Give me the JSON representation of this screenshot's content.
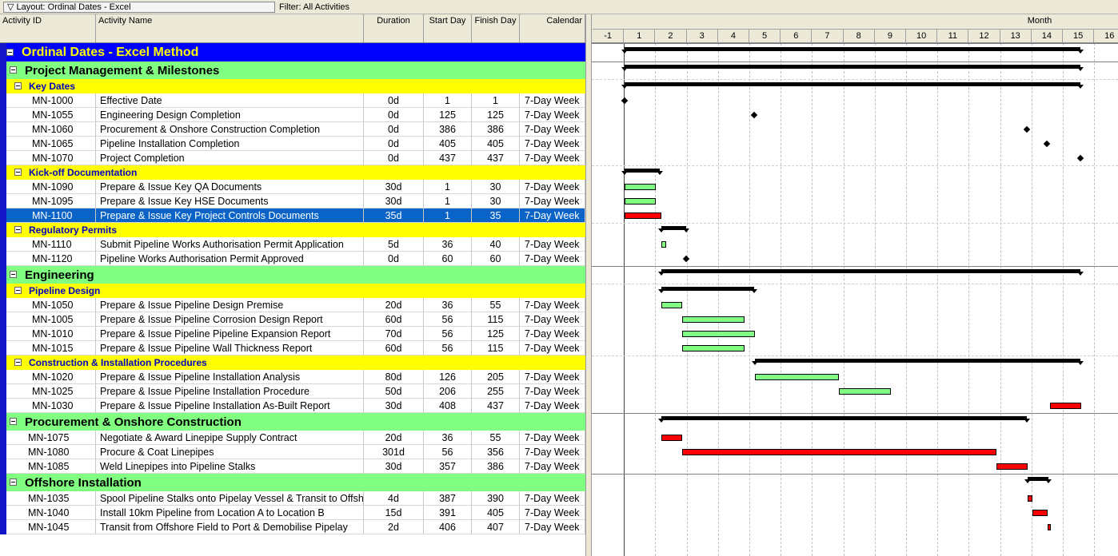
{
  "toolbar": {
    "layout_label": "Layout: Ordinal Dates - Excel",
    "filter_label": "Filter: All Activities"
  },
  "columns": {
    "id": "Activity ID",
    "name": "Activity Name",
    "duration": "Duration",
    "start": "Start Day",
    "finish": "Finish Day",
    "calendar": "Calendar"
  },
  "timescale": {
    "month_label": "Month",
    "ticks": [
      "-1",
      "1",
      "2",
      "3",
      "4",
      "5",
      "6",
      "7",
      "8",
      "9",
      "10",
      "11",
      "12",
      "13",
      "14",
      "15",
      "16"
    ]
  },
  "rows": [
    {
      "kind": "group",
      "level": 0,
      "title": "Ordinal Dates - Excel Method"
    },
    {
      "kind": "group",
      "level": 1,
      "title": "Project Management & Milestones"
    },
    {
      "kind": "group",
      "level": 2,
      "title": "Key Dates"
    },
    {
      "kind": "act",
      "id": "MN-1000",
      "name": "Effective Date",
      "dur": "0d",
      "sd": "1",
      "fd": "1",
      "cal": "7-Day Week"
    },
    {
      "kind": "act",
      "id": "MN-1055",
      "name": "Engineering Design Completion",
      "dur": "0d",
      "sd": "125",
      "fd": "125",
      "cal": "7-Day Week"
    },
    {
      "kind": "act",
      "id": "MN-1060",
      "name": "Procurement & Onshore Construction Completion",
      "dur": "0d",
      "sd": "386",
      "fd": "386",
      "cal": "7-Day Week"
    },
    {
      "kind": "act",
      "id": "MN-1065",
      "name": "Pipeline Installation Completion",
      "dur": "0d",
      "sd": "405",
      "fd": "405",
      "cal": "7-Day Week"
    },
    {
      "kind": "act",
      "id": "MN-1070",
      "name": "Project Completion",
      "dur": "0d",
      "sd": "437",
      "fd": "437",
      "cal": "7-Day Week"
    },
    {
      "kind": "group",
      "level": 2,
      "title": "Kick-off Documentation"
    },
    {
      "kind": "act",
      "id": "MN-1090",
      "name": "Prepare & Issue Key QA Documents",
      "dur": "30d",
      "sd": "1",
      "fd": "30",
      "cal": "7-Day Week"
    },
    {
      "kind": "act",
      "id": "MN-1095",
      "name": "Prepare & Issue Key HSE Documents",
      "dur": "30d",
      "sd": "1",
      "fd": "30",
      "cal": "7-Day Week"
    },
    {
      "kind": "act",
      "id": "MN-1100",
      "name": "Prepare & Issue Key Project Controls Documents",
      "dur": "35d",
      "sd": "1",
      "fd": "35",
      "cal": "7-Day Week",
      "selected": true
    },
    {
      "kind": "group",
      "level": 2,
      "title": "Regulatory Permits"
    },
    {
      "kind": "act",
      "id": "MN-1110",
      "name": "Submit Pipeline Works Authorisation Permit Application",
      "dur": "5d",
      "sd": "36",
      "fd": "40",
      "cal": "7-Day Week"
    },
    {
      "kind": "act",
      "id": "MN-1120",
      "name": "Pipeline Works Authorisation Permit Approved",
      "dur": "0d",
      "sd": "60",
      "fd": "60",
      "cal": "7-Day Week"
    },
    {
      "kind": "group",
      "level": 1,
      "title": "Engineering"
    },
    {
      "kind": "group",
      "level": 2,
      "title": "Pipeline Design"
    },
    {
      "kind": "act",
      "id": "MN-1050",
      "name": "Prepare & Issue Pipeline Design Premise",
      "dur": "20d",
      "sd": "36",
      "fd": "55",
      "cal": "7-Day Week"
    },
    {
      "kind": "act",
      "id": "MN-1005",
      "name": "Prepare & Issue Pipeline Corrosion Design Report",
      "dur": "60d",
      "sd": "56",
      "fd": "115",
      "cal": "7-Day Week"
    },
    {
      "kind": "act",
      "id": "MN-1010",
      "name": "Prepare & Issue Pipeline Pipeline Expansion Report",
      "dur": "70d",
      "sd": "56",
      "fd": "125",
      "cal": "7-Day Week"
    },
    {
      "kind": "act",
      "id": "MN-1015",
      "name": "Prepare & Issue Pipeline Wall Thickness Report",
      "dur": "60d",
      "sd": "56",
      "fd": "115",
      "cal": "7-Day Week"
    },
    {
      "kind": "group",
      "level": 2,
      "title": "Construction & Installation Procedures"
    },
    {
      "kind": "act",
      "id": "MN-1020",
      "name": "Prepare & Issue Pipeline Installation Analysis",
      "dur": "80d",
      "sd": "126",
      "fd": "205",
      "cal": "7-Day Week"
    },
    {
      "kind": "act",
      "id": "MN-1025",
      "name": "Prepare & Issue Pipeline Installation Procedure",
      "dur": "50d",
      "sd": "206",
      "fd": "255",
      "cal": "7-Day Week"
    },
    {
      "kind": "act",
      "id": "MN-1030",
      "name": "Prepare & Issue Pipeline Installation As-Built Report",
      "dur": "30d",
      "sd": "408",
      "fd": "437",
      "cal": "7-Day Week"
    },
    {
      "kind": "group",
      "level": 1,
      "title": "Procurement & Onshore Construction"
    },
    {
      "kind": "act",
      "id": "MN-1075",
      "name": "Negotiate & Award Linepipe Supply Contract",
      "dur": "20d",
      "sd": "36",
      "fd": "55",
      "cal": "7-Day Week",
      "indent": "shallow"
    },
    {
      "kind": "act",
      "id": "MN-1080",
      "name": "Procure & Coat Linepipes",
      "dur": "301d",
      "sd": "56",
      "fd": "356",
      "cal": "7-Day Week",
      "indent": "shallow"
    },
    {
      "kind": "act",
      "id": "MN-1085",
      "name": "Weld Linepipes into Pipeline Stalks",
      "dur": "30d",
      "sd": "357",
      "fd": "386",
      "cal": "7-Day Week",
      "indent": "shallow"
    },
    {
      "kind": "group",
      "level": 1,
      "title": "Offshore Installation"
    },
    {
      "kind": "act",
      "id": "MN-1035",
      "name": "Spool Pipeline Stalks onto Pipelay Vessel & Transit to Offshore Field",
      "dur": "4d",
      "sd": "387",
      "fd": "390",
      "cal": "7-Day Week",
      "indent": "shallow"
    },
    {
      "kind": "act",
      "id": "MN-1040",
      "name": "Install 10km Pipeline from Location A to Location B",
      "dur": "15d",
      "sd": "391",
      "fd": "405",
      "cal": "7-Day Week",
      "indent": "shallow"
    },
    {
      "kind": "act",
      "id": "MN-1045",
      "name": "Transit from Offshore Field to Port & Demobilise Pipelay",
      "dur": "2d",
      "sd": "406",
      "fd": "407",
      "cal": "7-Day Week",
      "indent": "shallow"
    }
  ],
  "gantt": {
    "critical": [
      "MN-1100",
      "MN-1030",
      "MN-1075",
      "MN-1080",
      "MN-1085",
      "MN-1035",
      "MN-1040",
      "MN-1045"
    ],
    "summaries": [
      [
        1,
        437
      ],
      [
        1,
        437
      ],
      [
        1,
        437
      ],
      [
        1,
        35
      ],
      [
        36,
        60
      ],
      [
        36,
        437
      ],
      [
        36,
        125
      ],
      [
        126,
        437
      ],
      [
        36,
        386
      ],
      [
        387,
        407
      ]
    ],
    "colors": {
      "normal_bar": "#80ff80",
      "critical_bar": "#ff0000",
      "wbs_l0": "#0000ff",
      "wbs_l1": "#80ff80",
      "wbs_l2": "#ffff00",
      "selection": "#0a64c8"
    }
  }
}
